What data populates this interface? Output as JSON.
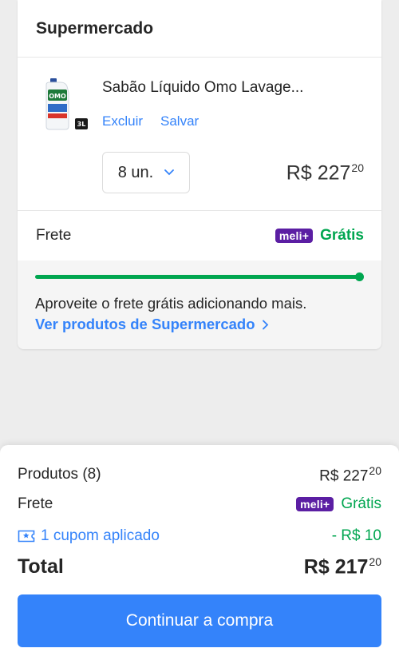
{
  "seller_card": {
    "title": "Supermercado",
    "item": {
      "name": "Sabão Líquido Omo Lavage...",
      "badge": "3L",
      "remove_label": "Excluir",
      "save_label": "Salvar",
      "quantity": "8 un.",
      "price_int": "R$ 227",
      "price_cents": "20"
    },
    "shipping": {
      "label": "Frete",
      "badge": "meli+",
      "value": "Grátis"
    },
    "progress": {
      "fill_percent": 100,
      "message": "Aproveite o frete grátis adicionando mais.",
      "link": "Ver produtos de Supermercado"
    }
  },
  "summary": {
    "products_label": "Produtos (8)",
    "products_int": "R$ 227",
    "products_cents": "20",
    "shipping_label": "Frete",
    "shipping_badge": "meli+",
    "shipping_value": "Grátis",
    "coupon_label": "1 cupom aplicado",
    "coupon_value": "- R$ 10",
    "total_label": "Total",
    "total_int": "R$ 217",
    "total_cents": "20",
    "continue_button": "Continuar a compra"
  },
  "colors": {
    "accent": "#3483fa",
    "green": "#00a650",
    "meli_purple": "#5b1ea3"
  }
}
